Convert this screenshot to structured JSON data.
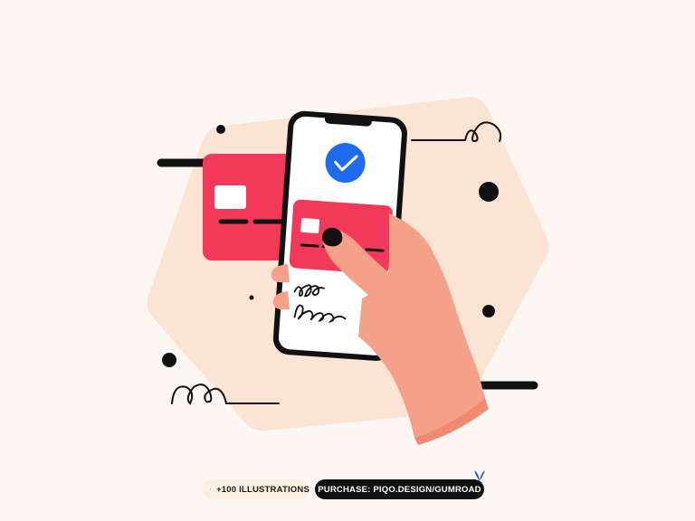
{
  "footer": {
    "illustrations_label": "+100 ILLUSTRATIONS",
    "purchase_label": "PURCHASE: PIQO.DESIGN/GUMROAD"
  },
  "colors": {
    "background": "#fdf7f4",
    "blob": "#fbe4d3",
    "card": "#f2395a",
    "check": "#1f6bef",
    "skin": "#f5a088",
    "ink": "#111111"
  }
}
